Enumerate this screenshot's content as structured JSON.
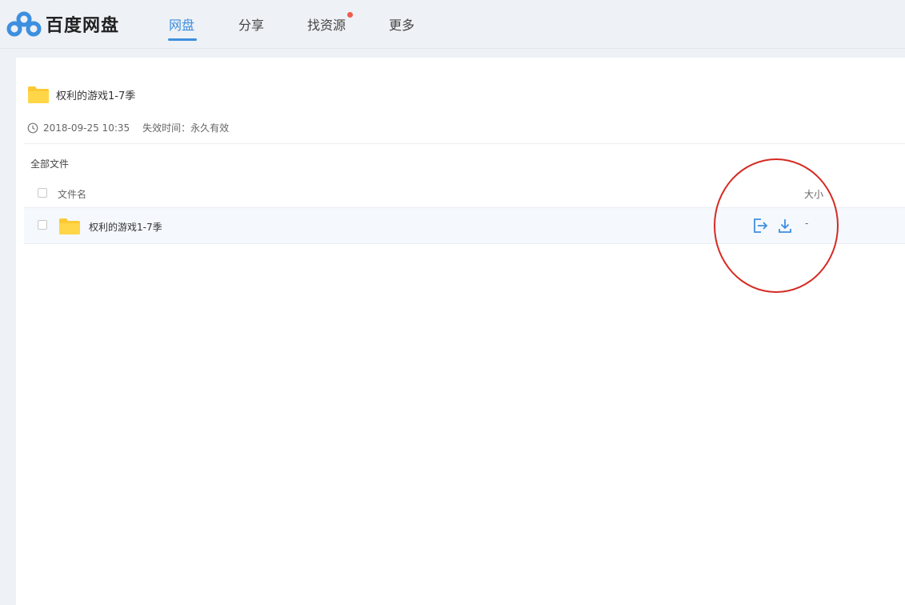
{
  "header": {
    "logo_text": "百度网盘",
    "nav": [
      {
        "label": "网盘",
        "active": true
      },
      {
        "label": "分享",
        "active": false
      },
      {
        "label": "找资源",
        "active": false,
        "has_dot": true
      },
      {
        "label": "更多",
        "active": false
      }
    ],
    "accent_color": "#3d8fdf",
    "dot_color": "#f25b4f"
  },
  "share": {
    "title": "权利的游戏1-7季",
    "date": "2018-09-25 10:35",
    "expire": "失效时间：永久有效",
    "icon": "folder-icon"
  },
  "file_list": {
    "breadcrumb": "全部文件",
    "columns": {
      "name": "文件名",
      "size": "大小"
    },
    "rows": [
      {
        "name": "权利的游戏1-7季",
        "size": "-",
        "icon": "folder-icon",
        "actions": [
          "save-to-netdisk-icon",
          "download-icon"
        ]
      }
    ]
  },
  "annotation": {
    "color": "#d52a22"
  }
}
